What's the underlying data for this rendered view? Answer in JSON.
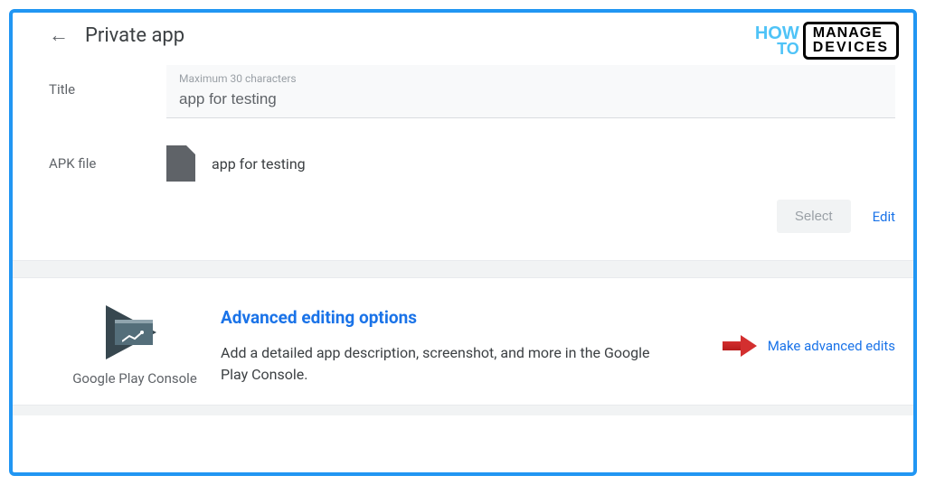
{
  "header": {
    "title": "Private app"
  },
  "logo": {
    "how": "HOW",
    "to": "TO",
    "manage": "MANAGE",
    "devices": "DEVICES"
  },
  "form": {
    "titleLabel": "Title",
    "titlePlaceholder": "Maximum 30 characters",
    "titleValue": "app for testing",
    "apkLabel": "APK file",
    "apkFileName": "app for testing"
  },
  "actions": {
    "select": "Select",
    "edit": "Edit"
  },
  "console": {
    "brandText": "Google Play Console"
  },
  "advanced": {
    "title": "Advanced editing options",
    "description": "Add a detailed app description, screenshot, and more in the Google Play Console.",
    "linkText": "Make advanced edits"
  }
}
